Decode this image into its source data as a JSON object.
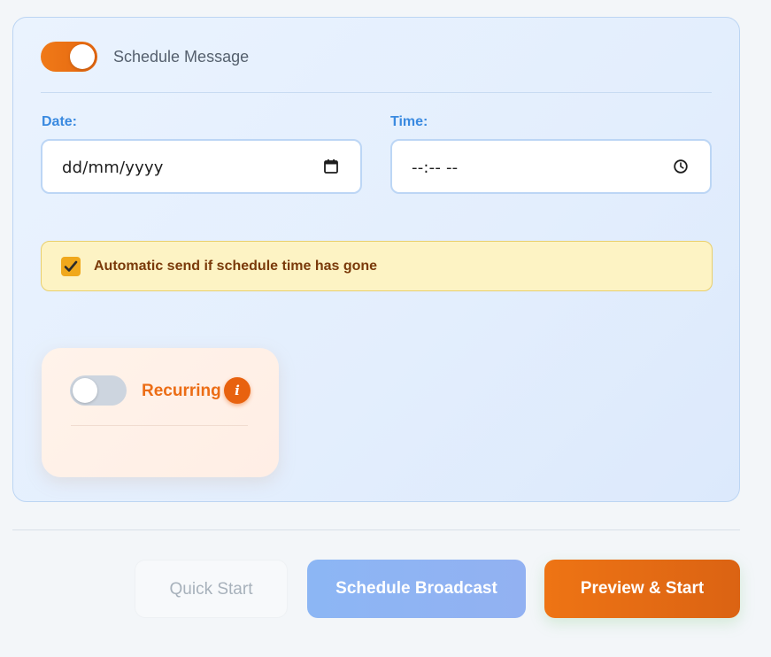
{
  "schedule": {
    "toggle_on": true,
    "label": "Schedule Message"
  },
  "date": {
    "label": "Date:",
    "placeholder": "dd/mm/yyyy",
    "icon": "calendar-icon"
  },
  "time": {
    "label": "Time:",
    "placeholder": "--:-- --",
    "icon": "clock-icon"
  },
  "auto_send": {
    "checked": true,
    "label": "Automatic send if schedule time has gone"
  },
  "recurring": {
    "toggle_on": false,
    "label": "Recurring",
    "info_icon": "info-icon"
  },
  "actions": {
    "quick_start": "Quick Start",
    "schedule_broadcast": "Schedule Broadcast",
    "preview_start": "Preview & Start"
  },
  "colors": {
    "accent_orange": "#e8620f",
    "accent_blue": "#3a8ae0",
    "warning_bg": "#fdf3c4"
  }
}
